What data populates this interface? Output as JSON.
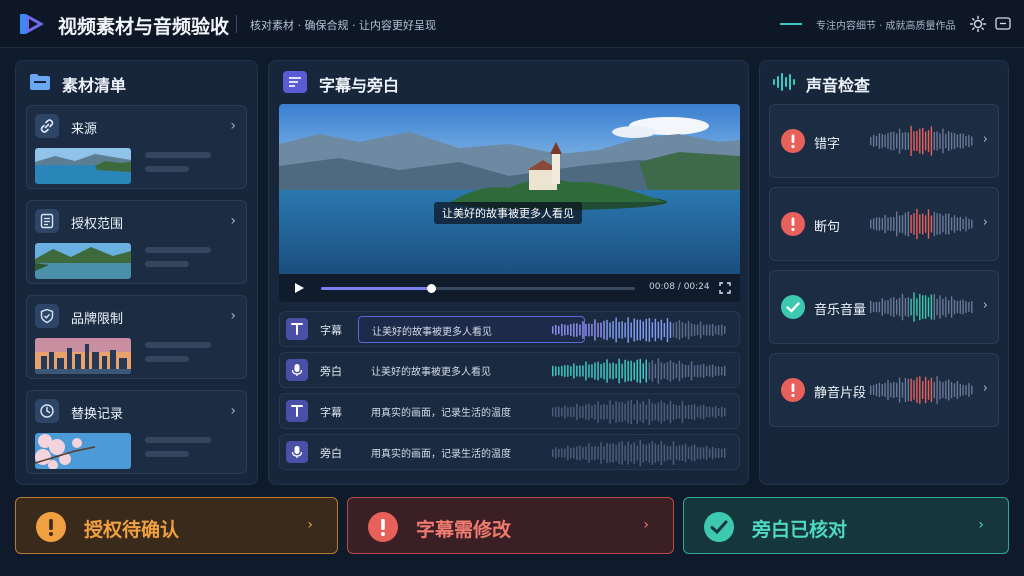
{
  "header": {
    "title": "视频素材与音频验收",
    "tagline": "核对素材 · 确保合规 · 让内容更好呈现",
    "right_text": "专注内容细节 · 成就高质量作品",
    "logo_icon": "play-logo-icon",
    "theme_icon": "sun-icon",
    "fullscreen_icon": "screen-icon"
  },
  "left_panel": {
    "title": "素材清单",
    "cards": [
      {
        "label": "来源",
        "icon": "link-icon"
      },
      {
        "label": "授权范围",
        "icon": "document-icon"
      },
      {
        "label": "品牌限制",
        "icon": "shield-icon"
      },
      {
        "label": "替换记录",
        "icon": "clock-icon"
      }
    ]
  },
  "center_panel": {
    "title": "字幕与旁白",
    "video": {
      "caption": "让美好的故事被更多人看见",
      "time": "00:08 / 00:24",
      "progress": 0.35
    },
    "rows": [
      {
        "type": "字幕",
        "text": "让美好的故事被更多人看见",
        "icon": "text-t-icon",
        "active": true
      },
      {
        "type": "旁白",
        "text": "让美好的故事被更多人看见",
        "icon": "mic-icon",
        "active": false
      },
      {
        "type": "字幕",
        "text": "用真实的画面，记录生活的温度",
        "icon": "text-t-icon",
        "active": false
      },
      {
        "type": "旁白",
        "text": "用真实的画面，记录生活的温度",
        "icon": "mic-icon",
        "active": false
      }
    ]
  },
  "right_panel": {
    "title": "声音检查",
    "items": [
      {
        "label": "错字",
        "status": "error",
        "accent": "#e8605a"
      },
      {
        "label": "断句",
        "status": "error",
        "accent": "#e8605a"
      },
      {
        "label": "音乐音量",
        "status": "ok",
        "accent": "#3cc9b0"
      },
      {
        "label": "静音片段",
        "status": "error",
        "accent": "#e8605a"
      }
    ]
  },
  "bottom": [
    {
      "label": "授权待确认",
      "status": "pending",
      "color": "#f0a040"
    },
    {
      "label": "字幕需修改",
      "status": "error",
      "color": "#e8605a"
    },
    {
      "label": "旁白已核对",
      "status": "ok",
      "color": "#3cc9b0"
    }
  ]
}
